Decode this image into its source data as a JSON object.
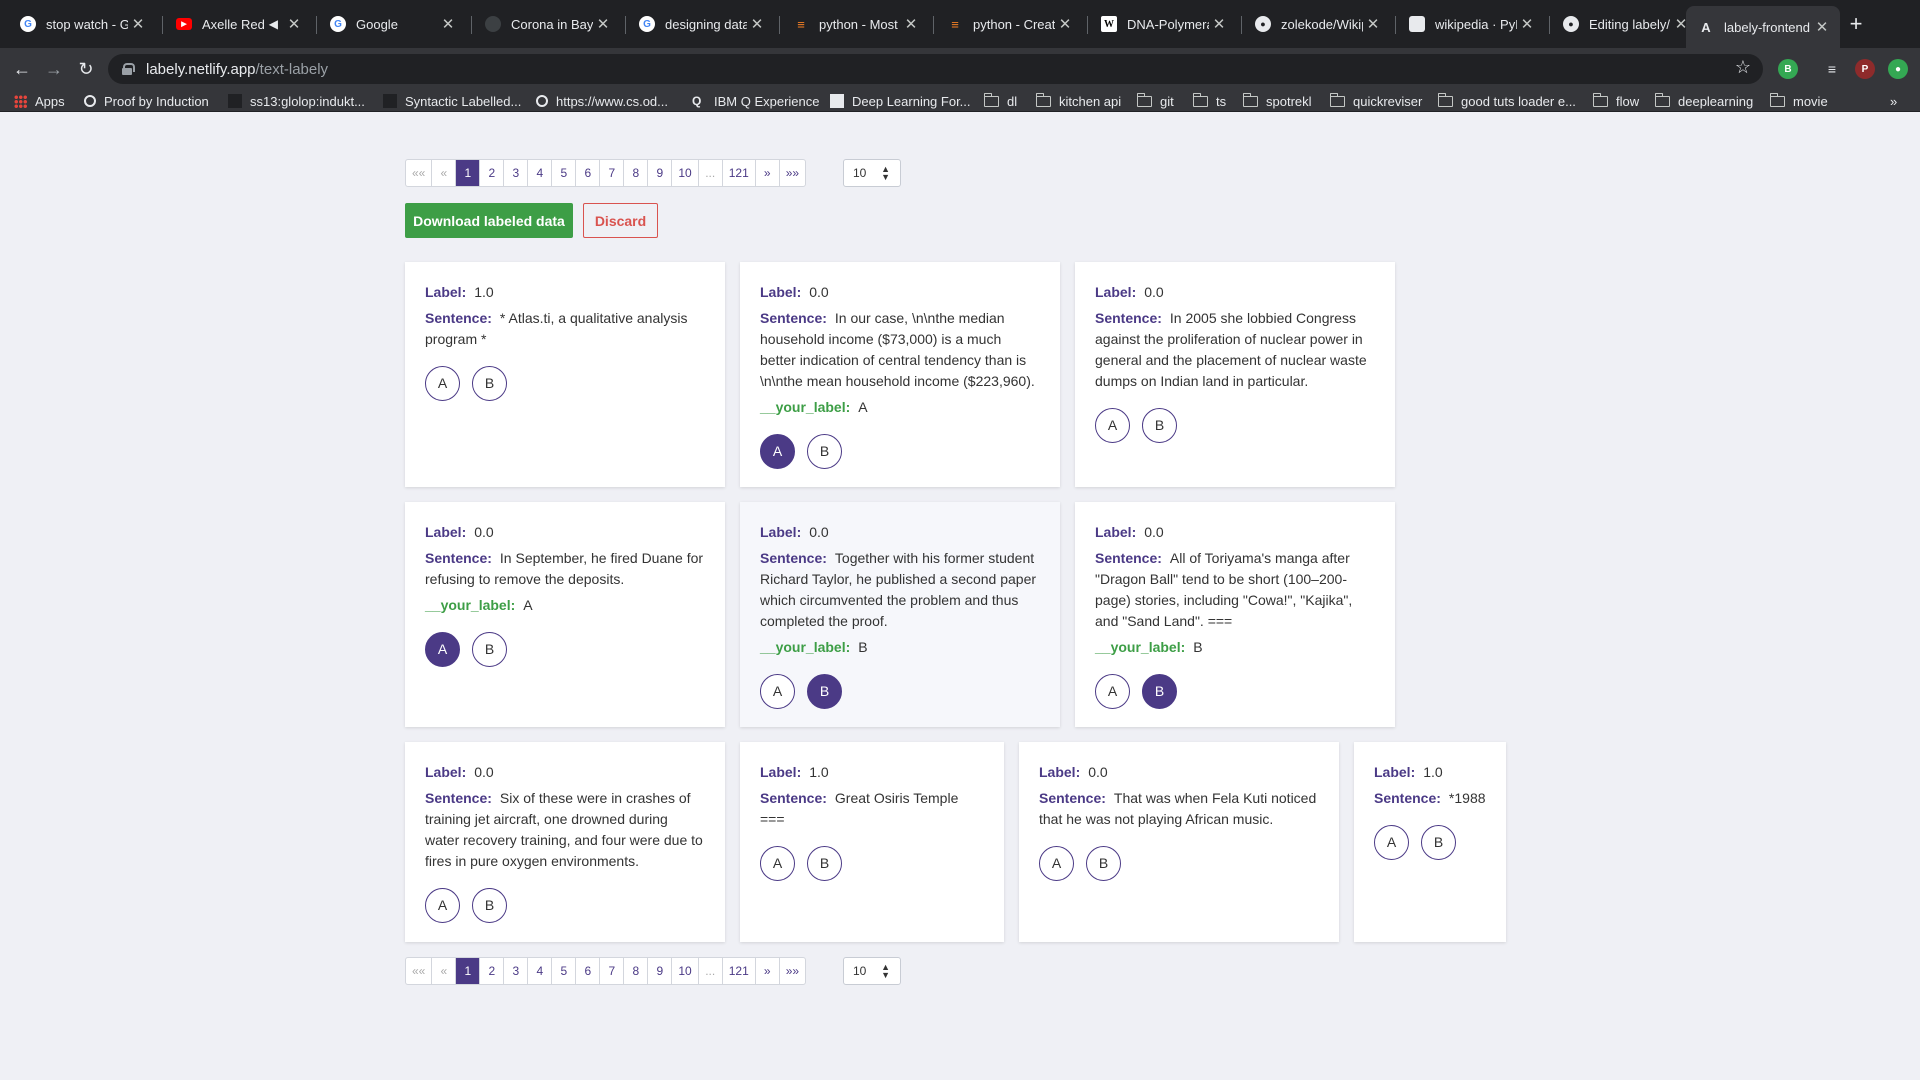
{
  "browser": {
    "tabs": [
      {
        "title": "stop watch - Google",
        "favicon": "google-icon"
      },
      {
        "title": "Axelle Red",
        "favicon": "youtube-icon",
        "muted": true
      },
      {
        "title": "Google",
        "favicon": "google-icon"
      },
      {
        "title": "Corona in Bayern",
        "favicon": "page-icon"
      },
      {
        "title": "designing data",
        "favicon": "google-icon"
      },
      {
        "title": "python - Most",
        "favicon": "stackoverflow-icon"
      },
      {
        "title": "python - Creati",
        "favicon": "stackoverflow-icon"
      },
      {
        "title": "DNA-Polymerase",
        "favicon": "wikipedia-icon"
      },
      {
        "title": "zolekode/Wikip",
        "favicon": "github-icon"
      },
      {
        "title": "wikipedia · PyPI",
        "favicon": "pypi-icon"
      },
      {
        "title": "Editing labely/R",
        "favicon": "github-icon"
      },
      {
        "title": "labely-frontend",
        "favicon": "netlify-icon",
        "active": true
      }
    ],
    "url_host": "labely.netlify.app",
    "url_path": "/text-labely",
    "profile_initial": "P",
    "bookmarks": [
      {
        "label": "Apps",
        "icon": "apps-icon"
      },
      {
        "label": "Proof by Induction",
        "icon": "globe-icon"
      },
      {
        "label": "ss13:glolop:indukt...",
        "icon": "page-icon"
      },
      {
        "label": "Syntactic Labelled...",
        "icon": "page-icon"
      },
      {
        "label": "https://www.cs.od...",
        "icon": "globe-icon"
      },
      {
        "label": "IBM Q Experience",
        "icon": "q-icon"
      },
      {
        "label": "Deep Learning For...",
        "icon": "page-icon"
      },
      {
        "label": "dl",
        "icon": "folder-icon"
      },
      {
        "label": "kitchen api",
        "icon": "folder-icon"
      },
      {
        "label": "git",
        "icon": "folder-icon"
      },
      {
        "label": "ts",
        "icon": "folder-icon"
      },
      {
        "label": "spotrekl",
        "icon": "folder-icon"
      },
      {
        "label": "quickreviser",
        "icon": "folder-icon"
      },
      {
        "label": "good tuts loader e...",
        "icon": "folder-icon"
      },
      {
        "label": "flow",
        "icon": "folder-icon"
      },
      {
        "label": "deeplearning",
        "icon": "folder-icon"
      },
      {
        "label": "movie",
        "icon": "folder-icon"
      }
    ],
    "more_bookmarks": "»"
  },
  "pagination": {
    "items": [
      "«‹",
      "‹",
      "1",
      "2",
      "3",
      "4",
      "5",
      "6",
      "7",
      "8",
      "9",
      "10",
      "...",
      "121",
      "›",
      "›»"
    ],
    "first": "««",
    "prev": "«",
    "pages": [
      "1",
      "2",
      "3",
      "4",
      "5",
      "6",
      "7",
      "8",
      "9",
      "10"
    ],
    "ellipsis": "...",
    "last_page": "121",
    "next": "»",
    "last": "»»",
    "current": "1",
    "per_page": "10"
  },
  "actions": {
    "download": "Download labeled data",
    "discard": "Discard"
  },
  "labels": {
    "label": "Label:",
    "sentence": "Sentence:",
    "your_label": "__your_label:",
    "choice_a": "A",
    "choice_b": "B"
  },
  "cards": [
    {
      "label": "1.0",
      "sentence": "* Atlas.ti, a qualitative analysis program *",
      "your_label": null
    },
    {
      "label": "0.0",
      "sentence": "In our case, \\n\\nthe median household income ($73,000) is a much better indication of central tendency than is \\n\\nthe mean household income ($223,960).",
      "your_label": "A"
    },
    {
      "label": "0.0",
      "sentence": "In 2005 she lobbied Congress against the proliferation of nuclear power in general and the placement of nuclear waste dumps on Indian land in particular.",
      "your_label": null
    },
    {
      "label": "0.0",
      "sentence": "In September, he fired Duane for refusing to remove the deposits.",
      "your_label": "A"
    },
    {
      "label": "0.0",
      "sentence": "Together with his former student Richard Taylor, he published a second paper which circumvented the problem and thus completed the proof.",
      "your_label": "B"
    },
    {
      "label": "0.0",
      "sentence": "All of Toriyama's manga after \"Dragon Ball\" tend to be short (100–200-page) stories, including \"Cowa!\", \"Kajika\", and \"Sand Land\". ===",
      "your_label": "B"
    },
    {
      "label": "0.0",
      "sentence": "Six of these were in crashes of training jet aircraft, one drowned during water recovery training, and four were due to fires in pure oxygen environments.",
      "your_label": null
    },
    {
      "label": "1.0",
      "sentence": "Great Osiris Temple ===",
      "your_label": null
    },
    {
      "label": "0.0",
      "sentence": "That was when Fela Kuti noticed that he was not playing African music.",
      "your_label": null
    },
    {
      "label": "1.0",
      "sentence": "*1988",
      "your_label": null
    }
  ],
  "colors": {
    "accent": "#4b3a86",
    "success": "#3d9e46",
    "danger": "#d9534f",
    "page_bg": "#eff0f5"
  }
}
